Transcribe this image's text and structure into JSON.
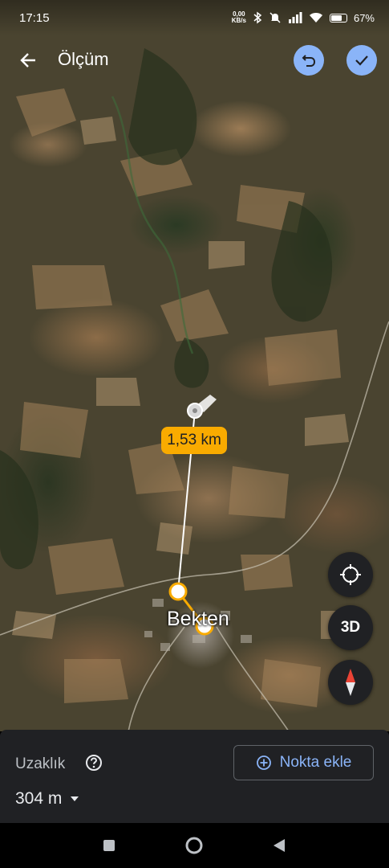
{
  "status_bar": {
    "time": "17:15",
    "net_speed_value": "0,00",
    "net_speed_unit": "KB/s",
    "battery": "67%"
  },
  "toolbar": {
    "title": "Ölçüm"
  },
  "map": {
    "distance_label": "1,53 km",
    "place_label": "Bekten",
    "control_3d": "3D"
  },
  "panel": {
    "distance_title": "Uzaklık",
    "distance_value": "304 m",
    "add_point_label": "Nokta ekle"
  },
  "colors": {
    "accent": "#8ab4f8",
    "measure_marker": "#f9ab00",
    "panel_bg": "#202124"
  }
}
